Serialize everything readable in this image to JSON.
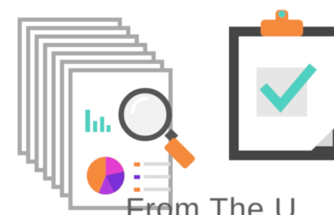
{
  "caption": {
    "text": "From The U"
  },
  "illustration": {
    "left_icon": "document-stack-search-icon",
    "right_icon": "clipboard-checkmark-icon"
  },
  "colors": {
    "stroke_gray": "#a9a9a9",
    "paper": "#ffffff",
    "teal": "#4fd1c1",
    "orange": "#f58a3c",
    "purple": "#7a2fd6",
    "magenta": "#e23ccf",
    "clipboard_border": "#444444",
    "clipboard_clip": "#f58a3c",
    "check_box_bg": "#e6e6e6",
    "lens_gray": "#555555",
    "list_line": "#d9dcdf"
  }
}
